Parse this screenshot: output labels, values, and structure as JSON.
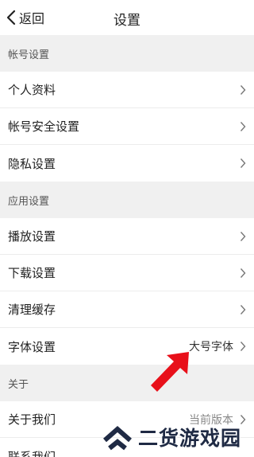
{
  "nav": {
    "back_label": "返回",
    "title": "设置"
  },
  "sections": [
    {
      "header": "帐号设置",
      "items": [
        {
          "label": "个人资料",
          "value": ""
        },
        {
          "label": "帐号安全设置",
          "value": ""
        },
        {
          "label": "隐私设置",
          "value": ""
        }
      ]
    },
    {
      "header": "应用设置",
      "items": [
        {
          "label": "播放设置",
          "value": ""
        },
        {
          "label": "下载设置",
          "value": ""
        },
        {
          "label": "清理缓存",
          "value": ""
        },
        {
          "label": "字体设置",
          "value": "大号字体"
        }
      ]
    },
    {
      "header": "关于",
      "items": [
        {
          "label": "关于我们",
          "value": "当前版本"
        },
        {
          "label": "联系我们",
          "value": ""
        }
      ]
    }
  ],
  "watermark": {
    "text": "二货游戏园"
  },
  "colors": {
    "section_bg": "#f0f0f0",
    "annotation_arrow": "#e8101a",
    "watermark_text": "#1f2a44"
  },
  "icons": {
    "back": "chevron-left-icon",
    "row_disclosure": "chevron-right-icon",
    "annotation": "red-arrow-icon",
    "watermark_logo": "double-chevron-up-logo"
  }
}
